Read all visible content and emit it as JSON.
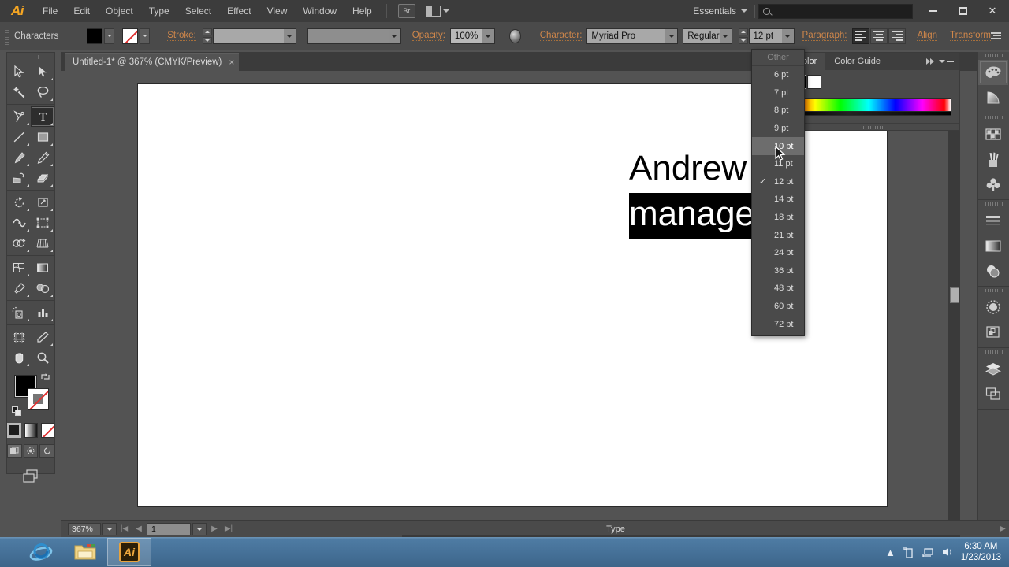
{
  "titlebar": {
    "app_logo": "Ai",
    "menus": [
      "File",
      "Edit",
      "Object",
      "Type",
      "Select",
      "Effect",
      "View",
      "Window",
      "Help"
    ],
    "bridge_label": "Br",
    "arrange_icon": "arrange-documents-icon",
    "workspace": "Essentials",
    "search_placeholder": "",
    "search_value": "",
    "window_buttons": [
      "minimize",
      "maximize",
      "close"
    ]
  },
  "controlbar": {
    "context_label": "Characters",
    "fill_label": "fill-swatch",
    "stroke_swatch_label": "stroke-swatch",
    "stroke_label": "Stroke:",
    "stroke_weight_value": "",
    "stroke_profile_value": "",
    "opacity_label": "Opacity:",
    "opacity_value": "100%",
    "character_label": "Character:",
    "font_family": "Myriad Pro",
    "font_style": "Regular",
    "font_size": "12 pt",
    "paragraph_label": "Paragraph:",
    "align_buttons": [
      "align-left",
      "align-center",
      "align-right"
    ],
    "align_active": "align-left",
    "align_link": "Align",
    "transform_link": "Transform"
  },
  "document_tab": {
    "title": "Untitled-1* @ 367% (CMYK/Preview)",
    "close_glyph": "×"
  },
  "toolbar": {
    "tools": [
      {
        "name": "selection-tool",
        "selected": false
      },
      {
        "name": "direct-selection-tool",
        "selected": false
      },
      {
        "name": "magic-wand-tool",
        "selected": false
      },
      {
        "name": "lasso-tool",
        "selected": false
      },
      {
        "name": "pen-tool",
        "selected": false
      },
      {
        "name": "type-tool",
        "selected": true
      },
      {
        "name": "line-segment-tool",
        "selected": false
      },
      {
        "name": "rectangle-tool",
        "selected": false
      },
      {
        "name": "paintbrush-tool",
        "selected": false
      },
      {
        "name": "pencil-tool",
        "selected": false
      },
      {
        "name": "blob-brush-tool",
        "selected": false
      },
      {
        "name": "eraser-tool",
        "selected": false
      },
      {
        "name": "rotate-tool",
        "selected": false
      },
      {
        "name": "scale-tool",
        "selected": false
      },
      {
        "name": "width-tool",
        "selected": false
      },
      {
        "name": "free-transform-tool",
        "selected": false
      },
      {
        "name": "shape-builder-tool",
        "selected": false
      },
      {
        "name": "perspective-grid-tool",
        "selected": false
      },
      {
        "name": "mesh-tool",
        "selected": false
      },
      {
        "name": "gradient-tool",
        "selected": false
      },
      {
        "name": "eyedropper-tool",
        "selected": false
      },
      {
        "name": "blend-tool",
        "selected": false
      },
      {
        "name": "symbol-sprayer-tool",
        "selected": false
      },
      {
        "name": "column-graph-tool",
        "selected": false
      },
      {
        "name": "artboard-tool",
        "selected": false
      },
      {
        "name": "slice-tool",
        "selected": false
      },
      {
        "name": "hand-tool",
        "selected": false
      },
      {
        "name": "zoom-tool",
        "selected": false
      }
    ],
    "fill_color": "#000000",
    "stroke_color": "none",
    "mode_buttons": [
      "color",
      "gradient",
      "none"
    ],
    "draw_modes": [
      "draw-normal",
      "draw-behind",
      "draw-inside"
    ],
    "screen_mode": "change-screen-mode"
  },
  "canvas": {
    "artboard_color": "#ffffff",
    "text_line1": "Andrew     th",
    "text_line2": "manage",
    "selection_highlight": "#000000"
  },
  "statusbar": {
    "zoom": "367%",
    "page_number": "1",
    "tool_indicator": "Type"
  },
  "color_panel": {
    "tabs": [
      "Color",
      "Color Guide"
    ],
    "active_tab": "Color",
    "fill_color": "#000000",
    "stroke_color": "#ffffff"
  },
  "icon_dock": {
    "groups": [
      [
        {
          "name": "color-panel-icon",
          "active": true
        },
        {
          "name": "color-guide-icon",
          "active": false
        }
      ],
      [
        {
          "name": "swatches-panel-icon",
          "active": false
        },
        {
          "name": "brushes-panel-icon",
          "active": false
        },
        {
          "name": "symbols-panel-icon",
          "active": false
        }
      ],
      [
        {
          "name": "stroke-panel-icon",
          "active": false
        },
        {
          "name": "gradient-panel-icon",
          "active": false
        },
        {
          "name": "transparency-panel-icon",
          "active": false
        }
      ],
      [
        {
          "name": "appearance-panel-icon",
          "active": false
        },
        {
          "name": "graphic-styles-panel-icon",
          "active": false
        }
      ],
      [
        {
          "name": "layers-panel-icon",
          "active": false
        },
        {
          "name": "artboards-panel-icon",
          "active": false
        }
      ]
    ]
  },
  "size_menu": {
    "items": [
      {
        "label": "Other",
        "checked": false,
        "hovered": false,
        "disabled": true
      },
      {
        "label": "6 pt",
        "checked": false,
        "hovered": false,
        "disabled": false
      },
      {
        "label": "7 pt",
        "checked": false,
        "hovered": false,
        "disabled": false
      },
      {
        "label": "8 pt",
        "checked": false,
        "hovered": false,
        "disabled": false
      },
      {
        "label": "9 pt",
        "checked": false,
        "hovered": false,
        "disabled": false
      },
      {
        "label": "10 pt",
        "checked": false,
        "hovered": true,
        "disabled": false
      },
      {
        "label": "11 pt",
        "checked": false,
        "hovered": false,
        "disabled": false
      },
      {
        "label": "12 pt",
        "checked": true,
        "hovered": false,
        "disabled": false
      },
      {
        "label": "14 pt",
        "checked": false,
        "hovered": false,
        "disabled": false
      },
      {
        "label": "18 pt",
        "checked": false,
        "hovered": false,
        "disabled": false
      },
      {
        "label": "21 pt",
        "checked": false,
        "hovered": false,
        "disabled": false
      },
      {
        "label": "24 pt",
        "checked": false,
        "hovered": false,
        "disabled": false
      },
      {
        "label": "36 pt",
        "checked": false,
        "hovered": false,
        "disabled": false
      },
      {
        "label": "48 pt",
        "checked": false,
        "hovered": false,
        "disabled": false
      },
      {
        "label": "60 pt",
        "checked": false,
        "hovered": false,
        "disabled": false
      },
      {
        "label": "72 pt",
        "checked": false,
        "hovered": false,
        "disabled": false
      }
    ],
    "check_glyph": "✓"
  },
  "taskbar": {
    "items": [
      {
        "name": "internet-explorer-icon",
        "running": false
      },
      {
        "name": "file-explorer-icon",
        "running": false
      },
      {
        "name": "illustrator-icon",
        "running": true,
        "label": "Ai"
      }
    ],
    "tray": [
      "show-hidden-icons",
      "flash-drive-icon",
      "network-icon",
      "volume-icon"
    ],
    "time": "6:30 AM",
    "date": "1/23/2013"
  }
}
